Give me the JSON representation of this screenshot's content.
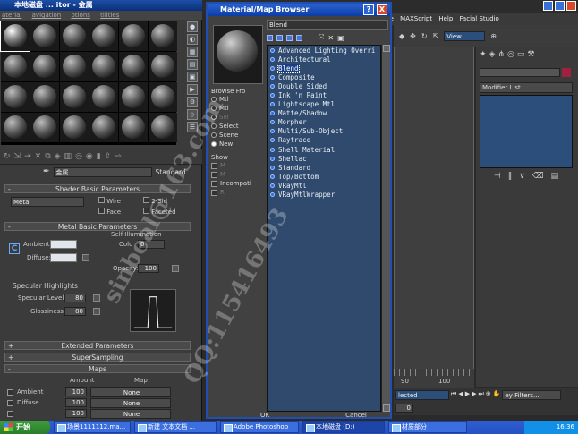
{
  "mat_editor": {
    "title": "本地磁盘 - 材质编辑器 - 金属",
    "title_visible": "本地磁盘 ... itor - 金属",
    "menu": [
      "aterial",
      "avigation",
      "ptions",
      "tilities"
    ],
    "material_name": "金属",
    "material_type": "Standard",
    "shader_rollout": "Shader Basic Parameters",
    "shader": "Metal",
    "wire": "Wire",
    "two_sided": "2-Sid",
    "face": "Face",
    "faceted": "Faceted",
    "metal_rollout": "Metal Basic Parameters",
    "self_illum": "Self-Illumination",
    "color_label": "Colo",
    "color_value": "0",
    "ambient": "Ambient:",
    "diffuse": "Diffuse:",
    "opacity_label": "Opacity:",
    "opacity_value": "100",
    "specular_group": "Specular Highlights",
    "specular_level_label": "Specular Level:",
    "specular_level_value": "80",
    "glossiness_label": "Glossiness:",
    "glossiness_value": "80",
    "extended": "Extended Parameters",
    "supersampling": "SuperSampling",
    "maps": "Maps",
    "maps_amount": "Amount",
    "maps_map": "Map",
    "map_rows": [
      {
        "label": "Ambient",
        "amount": "100",
        "map": "None"
      },
      {
        "label": "Diffuse",
        "amount": "100",
        "map": "None"
      },
      {
        "label": "",
        "amount": "100",
        "map": "None"
      }
    ],
    "sign_minus": "-",
    "sign_plus": "+"
  },
  "max_menu": [
    "ize",
    "MAXScript",
    "Help",
    "Facial Studio"
  ],
  "max_view_label": "View",
  "modifier_list": "Modifier List",
  "timeline": {
    "t90": "90",
    "t100": "100"
  },
  "anim": {
    "selected": "lected",
    "filters": "ey Filters...",
    "frame": "0"
  },
  "browser": {
    "title": "Material/Map Browser",
    "help": "?",
    "close": "X",
    "search": "Blend",
    "browse_from_label": "Browse Fro",
    "browse_from": [
      "Mtl",
      "Mtl",
      "Sel",
      "Select",
      "Scene",
      "New"
    ],
    "show_label": "Show",
    "show_opts": [
      "M",
      "M",
      "Incompati",
      "R"
    ],
    "items": [
      "Advanced Lighting Overri",
      "Architectural",
      "Blend",
      "Composite",
      "Double Sided",
      "Ink 'n Paint",
      "Lightscape Mtl",
      "Matte/Shadow",
      "Morpher",
      "Multi/Sub-Object",
      "Raytrace",
      "Shell Material",
      "Shellac",
      "Standard",
      "Top/Bottom",
      "VRayMtl",
      "VRayMtlWrapper"
    ],
    "selected_index": 2,
    "ok": "OK",
    "cancel": "Cancel"
  },
  "taskbar": {
    "start": "开始",
    "tasks": [
      "场景1111112.ma...",
      "新建 文本文档 ...",
      "Adobe Photoshop",
      "本地磁盘 (D:)",
      "材质部分"
    ],
    "active_index": 3,
    "time": "16:36"
  },
  "watermark": [
    "sinbeal@163.com",
    "QQ:115416493"
  ]
}
